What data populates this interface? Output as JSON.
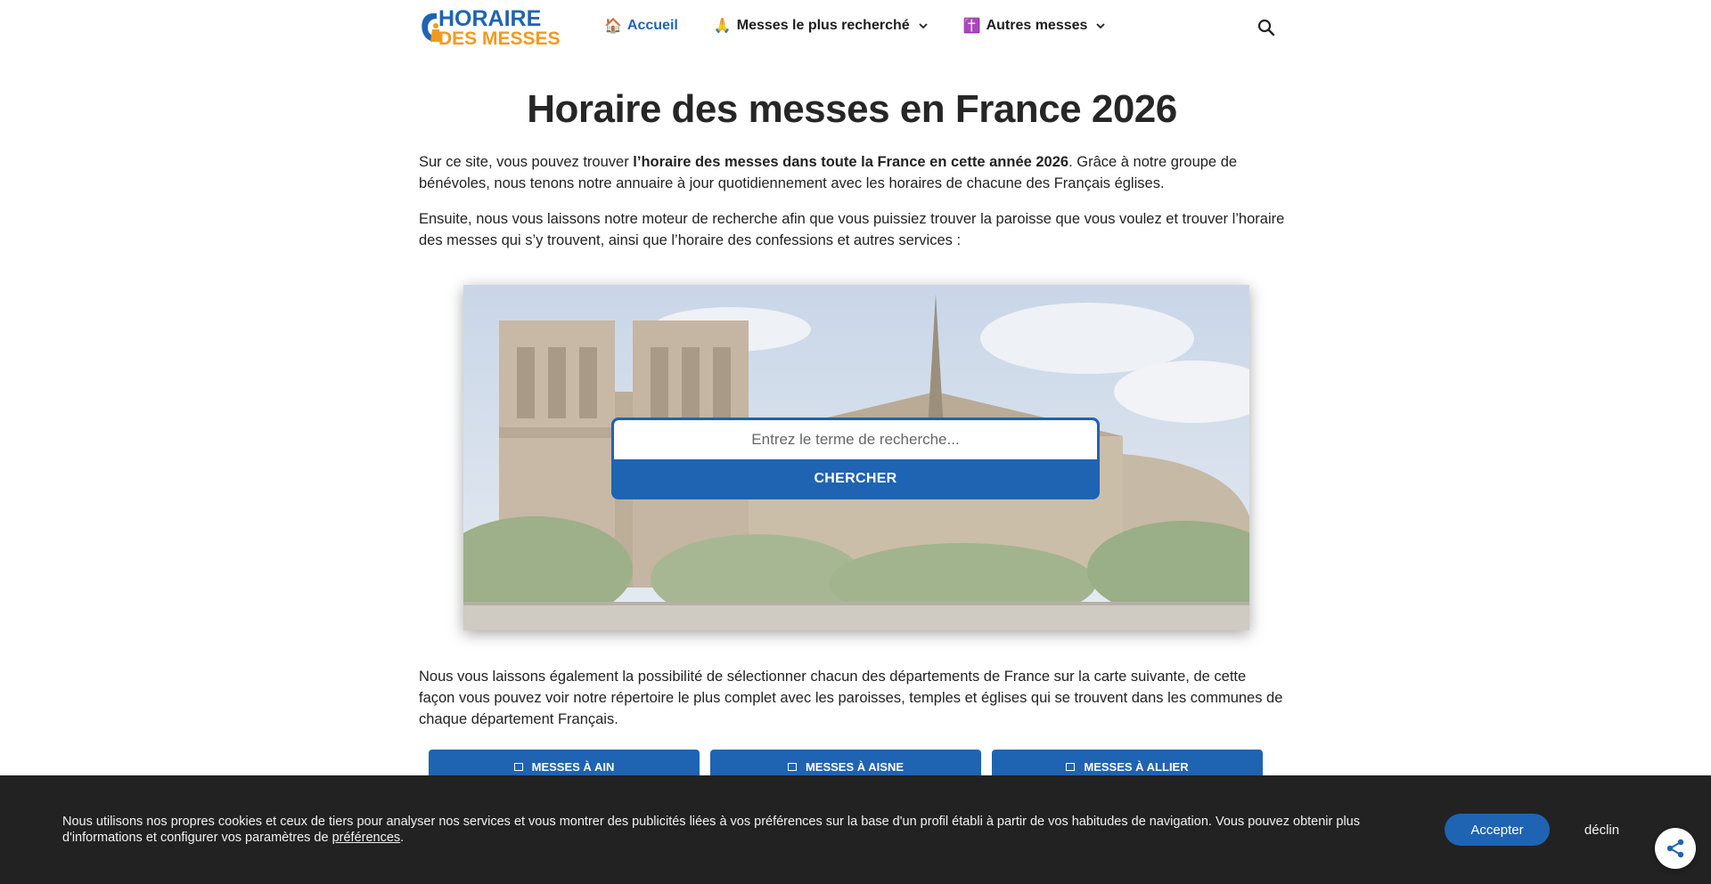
{
  "header": {
    "logo": {
      "line1": "HORAIRE",
      "line2": "DES MESSES"
    },
    "nav": [
      {
        "emoji": "🏠",
        "label": "Accueil",
        "active": true,
        "dropdown": false
      },
      {
        "emoji": "🙏",
        "label": "Messes le plus recherché",
        "active": false,
        "dropdown": true
      },
      {
        "emoji": "✝️",
        "label": "Autres messes",
        "active": false,
        "dropdown": true
      }
    ]
  },
  "main": {
    "title": "Horaire des messes en France 2026",
    "intro": {
      "before": "Sur ce site, vous pouvez trouver ",
      "bold": "l’horaire des messes dans toute la France en cette année 2026",
      "after": ". Grâce à notre groupe de bénévoles, nous tenons notre annuaire à jour quotidiennement avec les horaires de chacune des Français églises."
    },
    "paragraph2": "Ensuite, nous vous laissons notre moteur de recherche afin que vous puissiez trouver la paroisse que vous voulez et trouver l’horaire des messes qui s’y trouvent, ainsi que l’horaire des confessions et autres services :",
    "search": {
      "placeholder": "Entrez le terme de recherche...",
      "button": "CHERCHER"
    },
    "paragraph3": "Nous vous laissons également la possibilité de sélectionner chacun des départements de France sur la carte suivante, de cette façon vous pouvez voir notre répertoire le plus complet avec les paroisses, temples et églises qui se trouvent dans les communes de chaque département Français.",
    "departments": [
      "MESSES À AIN",
      "MESSES À AISNE",
      "MESSES À ALLIER"
    ]
  },
  "cookie": {
    "text": "Nous utilisons nos propres cookies et ceux de tiers pour analyser nos services et vous montrer des publicités liées à vos préférences sur la base d'un profil établi à partir de vos habitudes de navigation. Vous pouvez obtenir plus d'informations et configurer vos paramètres de ",
    "link": "préférences",
    "end": ".",
    "accept": "Accepter",
    "decline": "déclin"
  },
  "colors": {
    "brand_blue": "#1f63b3",
    "brand_orange": "#f29a1f",
    "cookie_bg": "#222222"
  }
}
